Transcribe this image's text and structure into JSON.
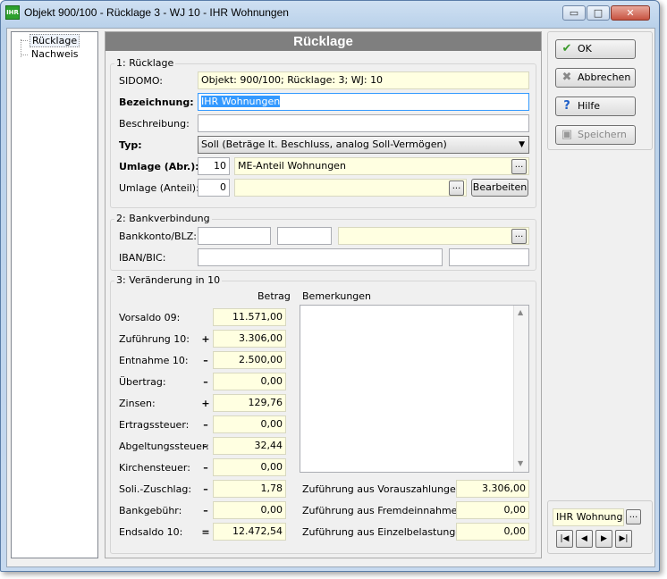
{
  "window": {
    "title": "Objekt 900/100 - Rücklage 3 - WJ 10 - IHR Wohnungen",
    "app_icon_text": "IHR",
    "minimize": "▭",
    "maximize": "□",
    "close": "✕"
  },
  "tree": {
    "items": [
      {
        "label": "Rücklage",
        "selected": true
      },
      {
        "label": "Nachweis",
        "selected": false
      }
    ]
  },
  "header": {
    "title": "Rücklage"
  },
  "section1": {
    "title": "1: Rücklage",
    "sidomo_label": "SIDOMO:",
    "sidomo_value": "Objekt: 900/100;  Rücklage: 3;  WJ: 10",
    "bezeichnung_label": "Bezeichnung:",
    "bezeichnung_value": "IHR Wohnungen",
    "beschreibung_label": "Beschreibung:",
    "beschreibung_value": "",
    "typ_label": "Typ:",
    "typ_value": "Soll (Beträge lt. Beschluss, analog Soll-Vermögen)",
    "umlage_abr_label": "Umlage (Abr.):",
    "umlage_abr_num": "10",
    "umlage_abr_text": "ME-Anteil Wohnungen",
    "umlage_anteil_label": "Umlage (Anteil):",
    "umlage_anteil_num": "0",
    "umlage_anteil_text": "",
    "bearbeiten": "Bearbeiten",
    "dots": "..."
  },
  "section2": {
    "title": "2: Bankverbindung",
    "bankkonto_label": "Bankkonto/BLZ:",
    "iban_label": "IBAN/BIC:",
    "bankkonto": "",
    "blz": "",
    "bankname": "",
    "iban": "",
    "bic": ""
  },
  "section3": {
    "title": "3: Veränderung in 10",
    "betrag_header": "Betrag",
    "bemerkungen_header": "Bemerkungen",
    "rows": [
      {
        "label": "Vorsaldo 09:",
        "sign": "",
        "value": "11.571,00"
      },
      {
        "label": "Zuführung 10:",
        "sign": "+",
        "value": "3.306,00"
      },
      {
        "label": "Entnahme 10:",
        "sign": "–",
        "value": "2.500,00"
      },
      {
        "label": "Übertrag:",
        "sign": "–",
        "value": "0,00"
      },
      {
        "label": "Zinsen:",
        "sign": "+",
        "value": "129,76"
      },
      {
        "label": "Ertragssteuer:",
        "sign": "–",
        "value": "0,00"
      },
      {
        "label": "Abgeltungssteuer:",
        "sign": "–",
        "value": "32,44"
      },
      {
        "label": "Kirchensteuer:",
        "sign": "–",
        "value": "0,00"
      },
      {
        "label": "Soli.-Zuschlag:",
        "sign": "–",
        "value": "1,78"
      },
      {
        "label": "Bankgebühr:",
        "sign": "–",
        "value": "0,00"
      },
      {
        "label": "Endsaldo 10:",
        "sign": "=",
        "value": "12.472,54"
      }
    ],
    "bemerkungen": "",
    "zufuehrung": [
      {
        "label": "Zuführung aus Vorauszahlungen:",
        "value": "3.306,00"
      },
      {
        "label": "Zuführung aus Fremdeinnahmen:",
        "value": "0,00"
      },
      {
        "label": "Zuführung aus Einzelbelastungen:",
        "value": "0,00"
      }
    ]
  },
  "sidebar": {
    "ok": "OK",
    "abbrechen": "Abbrechen",
    "hilfe": "Hilfe",
    "speichern": "Speichern"
  },
  "navigator": {
    "value": "IHR Wohnungen",
    "first": "|◀",
    "prev": "◀",
    "next": "▶",
    "last": "▶|"
  }
}
